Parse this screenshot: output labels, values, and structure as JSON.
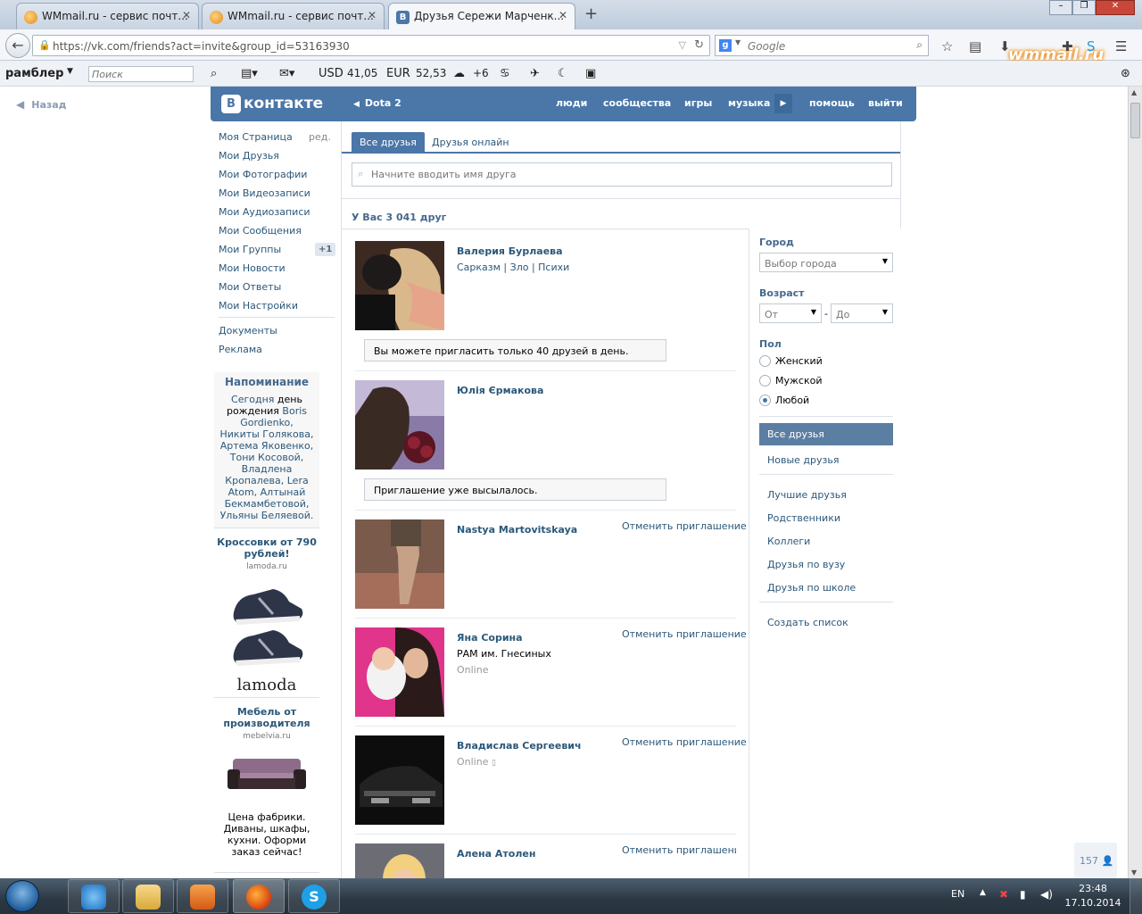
{
  "browser": {
    "tabs": [
      {
        "title": "WMmail.ru - сервис почт...",
        "favicon": "wmmail-icon"
      },
      {
        "title": "WMmail.ru - сервис почт...",
        "favicon": "wmmail-icon"
      },
      {
        "title": "Друзья Сережи Марченк...",
        "favicon": "vk-icon",
        "active": true
      }
    ],
    "url": "https://vk.com/friends?act=invite&group_id=53163930",
    "search_placeholder": "Google",
    "brand_logo": "wmmail.ru"
  },
  "rambler_bar": {
    "brand": "рамблер",
    "search_placeholder": "Поиск",
    "usd_label": "USD",
    "usd": "41,05",
    "eur_label": "EUR",
    "eur": "52,53",
    "weather": "+6"
  },
  "page": {
    "back_label": "Назад",
    "header": {
      "logo": "контакте",
      "logo_letter": "В",
      "back_group": "Dota 2",
      "nav": [
        "люди",
        "сообщества",
        "игры",
        "музыка",
        "помощь",
        "выйти"
      ]
    },
    "left_menu": {
      "items": [
        "Моя Страница",
        "Мои Друзья",
        "Мои Фотографии",
        "Мои Видеозаписи",
        "Мои Аудиозаписи",
        "Мои Сообщения",
        "Мои Группы",
        "Мои Новости",
        "Мои Ответы",
        "Мои Настройки"
      ],
      "edit_label": "ред.",
      "groups_badge": "+1",
      "extra": [
        "Документы",
        "Реклама"
      ]
    },
    "reminder": {
      "title": "Напоминание",
      "today": "Сегодня",
      "text_a": "день рождения",
      "names": "Boris Gordienko, Никиты Голякова, Артема Яковенко, Тони Косовой, Владлена Кропалева, Lera Atom, Алтынай Бекмамбетовой, Ульяны Беляевой."
    },
    "ads": [
      {
        "title": "Кроссовки от 790 рублей!",
        "domain": "lamoda.ru",
        "brand": "lamoda"
      },
      {
        "title": "Мебель от производителя",
        "domain": "mebelvia.ru",
        "text": "Цена фабрики. Диваны, шкафы, кухни. Оформи заказ сейчас!"
      }
    ],
    "friends": {
      "tabs": [
        "Все друзья",
        "Друзья онлайн"
      ],
      "search_placeholder": "Начните вводить имя друга",
      "count_text": "У Вас 3 041 друг",
      "list": [
        {
          "name": "Валерия Бурлаева",
          "info": "Сарказм | Зло | Психи",
          "notice": "Вы можете пригласить только 40 друзей в день."
        },
        {
          "name": "Юлія Єрмакова",
          "notice": "Приглашение уже высылалось."
        },
        {
          "name": "Nastya Martovitskaya",
          "action": "Отменить приглашение"
        },
        {
          "name": "Яна Сорина",
          "info": "РАМ им. Гнесиных",
          "status": "Online",
          "action": "Отменить приглашение"
        },
        {
          "name": "Владислав Сергеевич",
          "status": "Online",
          "action": "Отменить приглашение"
        },
        {
          "name": "Алена Атолен",
          "action": "Отменить приглашение"
        }
      ]
    },
    "filters": {
      "city_label": "Город",
      "city_select": "Выбор города",
      "age_label": "Возраст",
      "age_from": "От",
      "age_to": "До",
      "age_dash": "-",
      "sex_label": "Пол",
      "sex_options": [
        "Женский",
        "Мужской",
        "Любой"
      ],
      "sex_selected": "Любой",
      "lists_selected": "Все друзья",
      "lists": [
        "Новые друзья",
        "Лучшие друзья",
        "Родственники",
        "Коллеги",
        "Друзья по вузу",
        "Друзья по школе"
      ],
      "create_list": "Создать список"
    },
    "online_counter": "157"
  },
  "taskbar": {
    "lang": "EN",
    "time": "23:48",
    "date": "17.10.2014"
  },
  "colors": {
    "vk_blue": "#4a76a8",
    "link": "#2b587a"
  }
}
